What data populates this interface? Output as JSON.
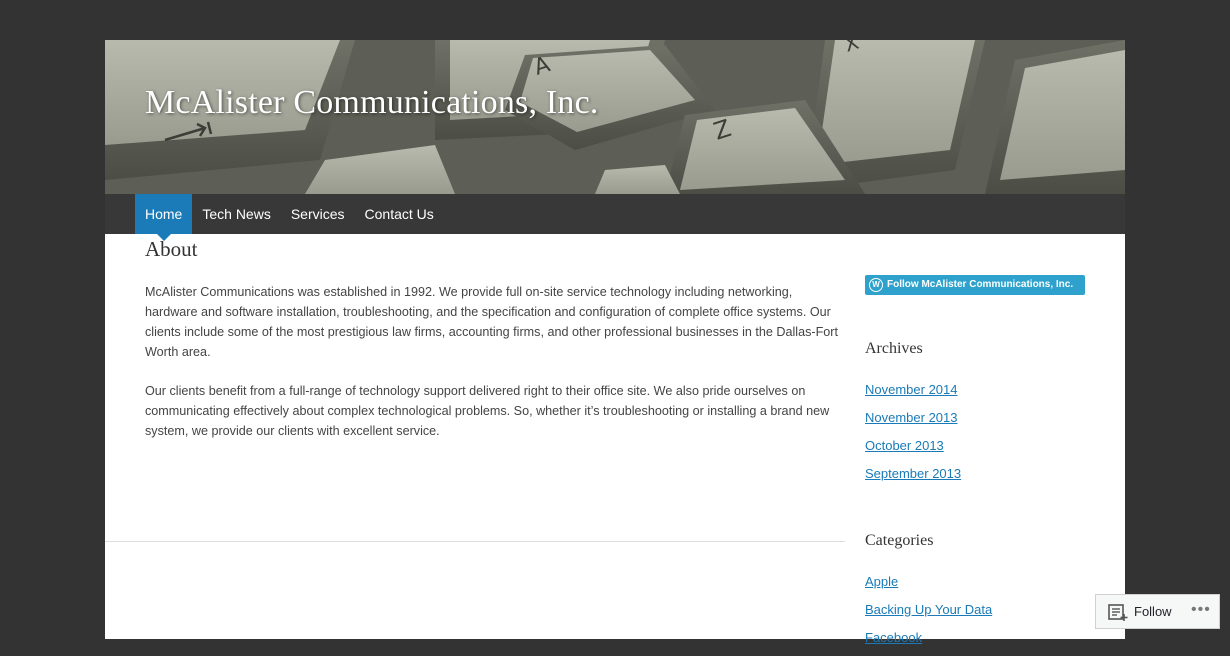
{
  "site": {
    "title": "McAlister Communications, Inc."
  },
  "nav": {
    "items": [
      {
        "label": "Home",
        "active": true
      },
      {
        "label": "Tech News",
        "active": false
      },
      {
        "label": "Services",
        "active": false
      },
      {
        "label": "Contact Us",
        "active": false
      }
    ]
  },
  "page": {
    "title": "About",
    "paragraphs": [
      "McAlister Communications was established in 1992. We provide full on-site service technology including networking, hardware and software installation, troubleshooting, and the specification and configuration of complete office systems. Our clients include some of the most prestigious law firms, accounting firms, and other professional businesses in the Dallas-Fort Worth area.",
      "Our clients benefit from a full-range of technology support delivered right to their office site. We also pride ourselves on communicating effectively about complex technological problems. So, whether it’s troubleshooting or installing a brand new system, we provide our clients with excellent service."
    ]
  },
  "sidebar": {
    "follow_button": "Follow McAlister Communications, Inc.",
    "archives": {
      "title": "Archives",
      "items": [
        "November 2014",
        "November 2013",
        "October 2013",
        "September 2013"
      ]
    },
    "categories": {
      "title": "Categories",
      "items": [
        "Apple",
        "Backing Up Your Data",
        "Facebook"
      ]
    }
  },
  "follow_bar": {
    "label": "Follow",
    "more": "•••"
  },
  "colors": {
    "accent": "#1a7bb8",
    "background": "#333333",
    "nav": "#383838",
    "follow_button": "#2ea2cc"
  },
  "icons": {
    "wordpress": "wordpress-icon",
    "reader": "reader-icon",
    "more": "more-icon"
  }
}
